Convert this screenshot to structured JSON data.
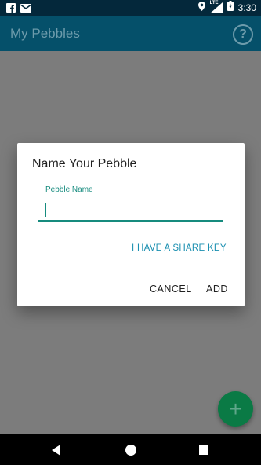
{
  "status_bar": {
    "time": "3:30",
    "network_label": "LTE",
    "left_icons": [
      "facebook-icon",
      "gmail-icon"
    ],
    "right_icons": [
      "location-icon",
      "signal-icon",
      "battery-icon"
    ]
  },
  "app_bar": {
    "title": "My Pebbles",
    "help_symbol": "?"
  },
  "dialog": {
    "title": "Name Your Pebble",
    "field_label": "Pebble Name",
    "field_value": "",
    "share_key_label": "I HAVE A SHARE KEY",
    "cancel_label": "CANCEL",
    "add_label": "ADD"
  },
  "fab": {
    "symbol": "+"
  },
  "colors": {
    "accent": "#168b7e",
    "link": "#1a8fb0",
    "app_bar": "#05506a",
    "fab": "#0a7a45"
  }
}
